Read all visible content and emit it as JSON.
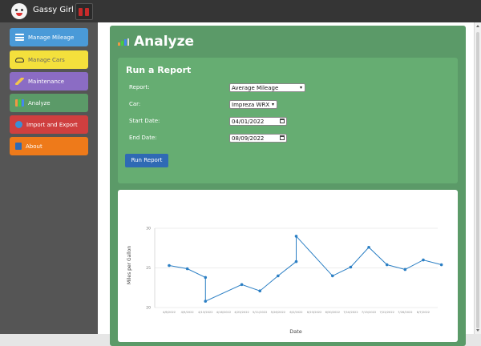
{
  "app": {
    "title": "Gassy Girl"
  },
  "sidebar": {
    "items": [
      {
        "label": "Manage Mileage",
        "color": "#4a9ad8",
        "text_color": "#ffffff"
      },
      {
        "label": "Manage Cars",
        "color": "#f4e03c",
        "text_color": "#666666"
      },
      {
        "label": "Maintenance",
        "color": "#8b6cc4",
        "text_color": "#ffffff"
      },
      {
        "label": "Analyze",
        "color": "#5b9a68",
        "text_color": "#ffffff"
      },
      {
        "label": "Import and Export",
        "color": "#cf3f3f",
        "text_color": "#ffffff"
      },
      {
        "label": "About",
        "color": "#ee7a1a",
        "text_color": "#ffffff"
      }
    ]
  },
  "page": {
    "title": "Analyze"
  },
  "report_form": {
    "title": "Run a Report",
    "report_label": "Report:",
    "report_value": "Average Mileage",
    "car_label": "Car:",
    "car_value": "Impreza WRX",
    "start_label": "Start Date:",
    "start_value": "04/01/2022",
    "end_label": "End Date:",
    "end_value": "08/09/2022",
    "run_label": "Run Report"
  },
  "chart_data": {
    "type": "line",
    "title": "",
    "xlabel": "Date",
    "ylabel": "Miles per Gallon",
    "y_ticks": [
      "30",
      "25",
      "20"
    ],
    "ylim": [
      20,
      30
    ],
    "grid": true,
    "categories": [
      "4/6/2022",
      "4/9/2022",
      "4/13/2022",
      "4/16/2022",
      "4/23/2022",
      "5/11/2022",
      "5/26/2022",
      "6/2/2022",
      "6/23/2022",
      "6/30/2022",
      "7/10/2022",
      "7/15/2022",
      "7/22/2022",
      "7/26/2022",
      "8/7/2022"
    ],
    "series": [
      {
        "color": "#2b7fc4",
        "points": [
          [
            0,
            25.3
          ],
          [
            1,
            24.9
          ],
          [
            2,
            23.8
          ],
          [
            2,
            20.8
          ],
          [
            4,
            22.9
          ],
          [
            5,
            22.1
          ],
          [
            6,
            24.0
          ],
          [
            7,
            25.8
          ],
          [
            7,
            29.0
          ],
          [
            9,
            24.0
          ],
          [
            10,
            25.1
          ],
          [
            11,
            27.6
          ],
          [
            12,
            25.4
          ],
          [
            13,
            24.8
          ],
          [
            14,
            26.0
          ],
          [
            15,
            25.4
          ]
        ]
      }
    ]
  }
}
